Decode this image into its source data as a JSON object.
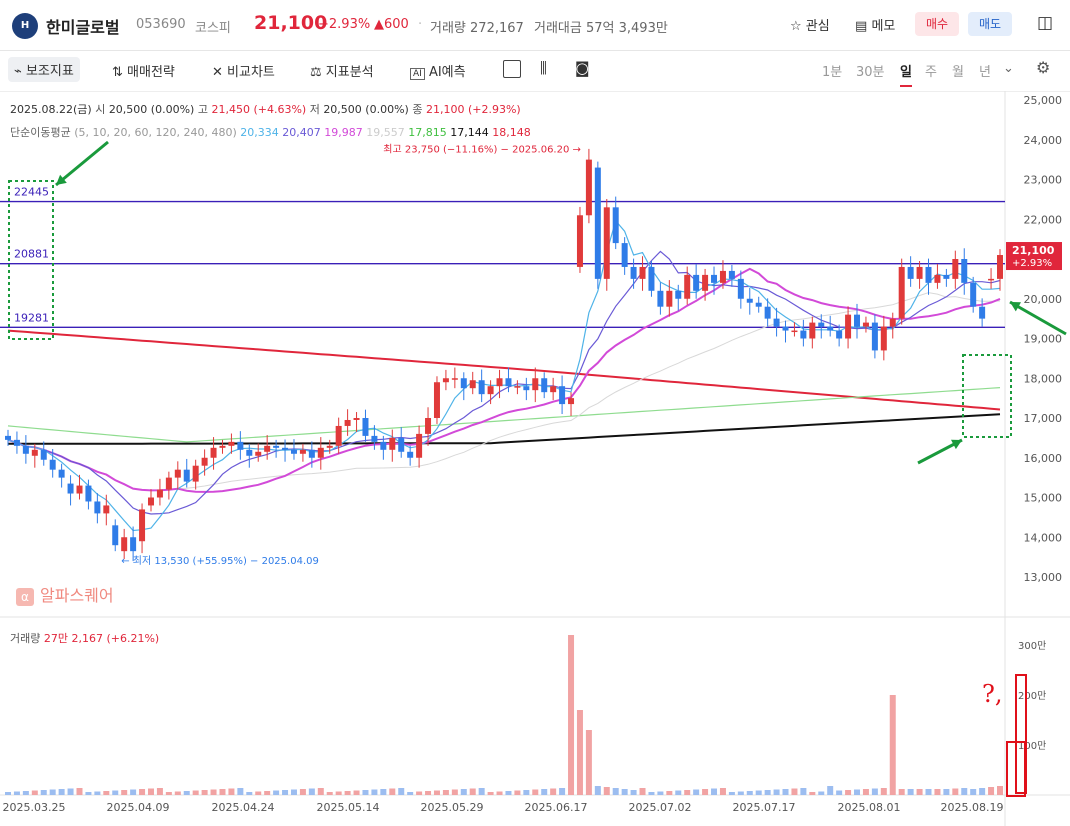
{
  "header": {
    "logo": "H",
    "name": "한미글로벌",
    "code": "053690",
    "market": "코스피",
    "price": "21,100",
    "change_pct": "+2.93%",
    "change_amt": "▲600",
    "volume_label": "거래량",
    "volume": "272,167",
    "amount_label": "거래대금",
    "amount": "57억 3,493만",
    "watch": "관심",
    "memo": "메모",
    "buy": "매수",
    "sell": "매도"
  },
  "toolbar": {
    "indicators": "보조지표",
    "strategy": "매매전략",
    "compare": "비교차트",
    "analysis": "지표분석",
    "ai": "AI예측",
    "periods": [
      "1분",
      "30분",
      "일",
      "주",
      "월",
      "년"
    ],
    "active_period": "일"
  },
  "info": {
    "date": "2025.08.22(금)",
    "open_label": "시",
    "open": "20,500 (0.00%)",
    "high_label": "고",
    "high": "21,450 (+4.63%)",
    "low_label": "저",
    "low": "20,500 (0.00%)",
    "close_label": "종",
    "close": "21,100 (+2.93%)",
    "ma_label": "단순이동평균",
    "ma_periods": "(5, 10, 20, 60, 120, 240, 480)",
    "ma_values": [
      "20,334",
      "20,407",
      "19,987",
      "19,557",
      "17,815",
      "17,144",
      "18,148"
    ],
    "ma_colors": [
      "#4fb3e8",
      "#6a5ad6",
      "#d24ad8",
      "#cccccc",
      "#6ed36e",
      "#111111",
      "#e0263b"
    ]
  },
  "annotations": {
    "high_note": "최고 23,750 (−11.16%) − 2025.06.20",
    "low_note": "최저 13,530 (+55.95%) − 2025.04.09",
    "hlines": [
      22445,
      20881,
      19281
    ],
    "hline_labels": [
      "22445",
      "20881",
      "19281"
    ],
    "hline_color": "#3a1fb8",
    "marker": "?,"
  },
  "volume_panel": {
    "label": "거래량",
    "value": "27만 2,167 (+6.21%)",
    "axis": [
      "300만",
      "200만",
      "100만"
    ]
  },
  "watermark": "알파스퀘어",
  "chart_data": {
    "type": "candlestick",
    "yaxis_ticks": [
      "25,000",
      "24,000",
      "23,000",
      "22,000",
      "21,000",
      "20,000",
      "19,000",
      "18,000",
      "17,000",
      "16,000",
      "15,000",
      "14,000",
      "13,000"
    ],
    "ylim": [
      12500,
      25300
    ],
    "last_price_label": [
      "21,100",
      "+2.93%"
    ],
    "x_labels": [
      "2025.03.25",
      "2025.04.09",
      "2025.04.24",
      "2025.05.14",
      "2025.05.29",
      "2025.06.17",
      "2025.07.02",
      "2025.07.17",
      "2025.08.01",
      "2025.08.19"
    ],
    "closes": [
      16450,
      16300,
      16100,
      16200,
      15950,
      15700,
      15500,
      15100,
      15300,
      14900,
      14600,
      14800,
      13800,
      14000,
      13650,
      14700,
      15000,
      15200,
      15500,
      15700,
      15400,
      15800,
      16000,
      16250,
      16300,
      16400,
      16200,
      16050,
      16150,
      16300,
      16250,
      16200,
      16100,
      16200,
      16000,
      16250,
      16300,
      16800,
      16950,
      17000,
      16550,
      16400,
      16200,
      16500,
      16150,
      16000,
      16600,
      17000,
      17900,
      18000,
      18000,
      17750,
      17950,
      17600,
      17800,
      18000,
      17800,
      17800,
      17700,
      18000,
      17650,
      17800,
      17350,
      17500,
      22100,
      23500,
      20500,
      22300,
      21400,
      20800,
      20500,
      20800,
      20200,
      19800,
      20200,
      20000,
      20600,
      20200,
      20600,
      20400,
      20700,
      20500,
      20000,
      19900,
      19800,
      19500,
      19300,
      19200,
      19200,
      19000,
      19400,
      19300,
      19200,
      19000,
      19600,
      19300,
      19400,
      18700,
      19300,
      19500,
      20800,
      20500,
      20800,
      20400,
      20600,
      20500,
      21000,
      20400,
      19800,
      19500,
      20500,
      21100
    ],
    "opens": [
      16550,
      16450,
      16300,
      16050,
      16200,
      15950,
      15700,
      15350,
      15100,
      15300,
      14900,
      14600,
      14300,
      13650,
      14000,
      13900,
      14800,
      15000,
      15200,
      15500,
      15700,
      15400,
      15800,
      16000,
      16250,
      16300,
      16400,
      16200,
      16050,
      16150,
      16300,
      16250,
      16200,
      16100,
      16200,
      16000,
      16250,
      16300,
      16800,
      16950,
      17000,
      16550,
      16400,
      16200,
      16500,
      16150,
      16000,
      16600,
      17000,
      17900,
      18000,
      18000,
      17750,
      17950,
      17600,
      17800,
      18000,
      17800,
      17800,
      17700,
      18000,
      17650,
      17800,
      17350,
      20800,
      22100,
      23300,
      20500,
      22300,
      21400,
      20800,
      20500,
      20800,
      20200,
      19800,
      20200,
      20000,
      20600,
      20200,
      20600,
      20400,
      20700,
      20500,
      20000,
      19900,
      19800,
      19500,
      19300,
      19200,
      19200,
      19000,
      19400,
      19300,
      19200,
      19000,
      19600,
      19300,
      19400,
      18700,
      19300,
      19500,
      20800,
      20500,
      20800,
      20400,
      20600,
      20500,
      21000,
      20400,
      19800,
      20500,
      20500
    ],
    "volume_peaks_man": {
      "2025.06.17": 320,
      "2025.06.18": 170,
      "2025.06.19": 130,
      "2025.08.01": 200
    }
  }
}
